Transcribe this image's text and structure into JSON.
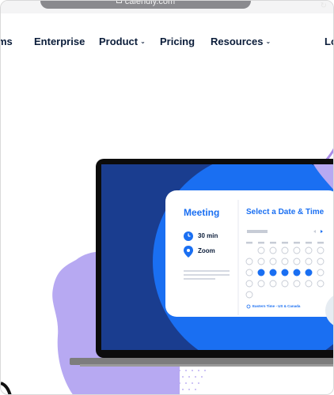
{
  "browser": {
    "url": "calendly.com"
  },
  "nav": {
    "items": [
      {
        "label": "ms",
        "has_dropdown": false
      },
      {
        "label": "Enterprise",
        "has_dropdown": false
      },
      {
        "label": "Product",
        "has_dropdown": true
      },
      {
        "label": "Pricing",
        "has_dropdown": false
      },
      {
        "label": "Resources",
        "has_dropdown": true
      },
      {
        "label": "Lo",
        "has_dropdown": false
      }
    ]
  },
  "hero": {
    "booking_card": {
      "event_title": "Meeting",
      "duration": "30 min",
      "location": "Zoom",
      "picker_title": "Select a Date & Time",
      "timezone": "Eastern Time - US & Canada"
    }
  },
  "colors": {
    "brand_blue": "#1a6ff2",
    "navy": "#0b1d3a",
    "lavender": "#b7a9f2",
    "screen_dark": "#1a3d8f"
  }
}
